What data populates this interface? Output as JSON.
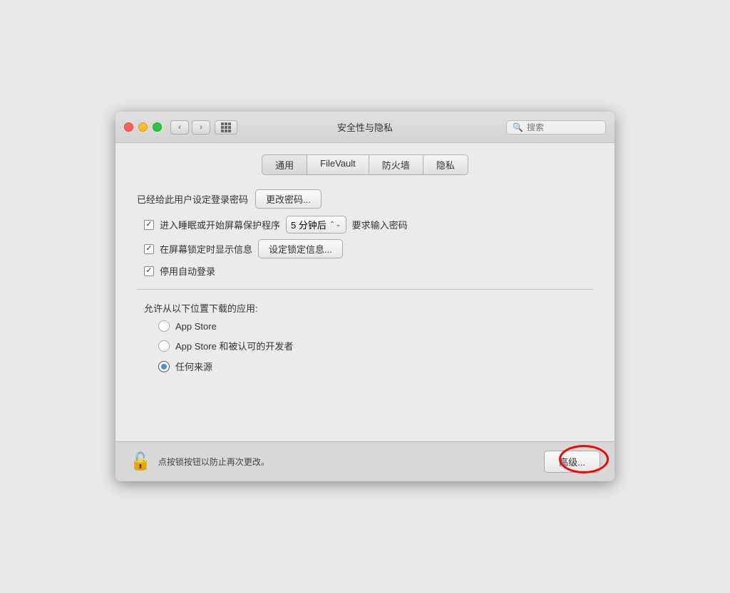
{
  "window": {
    "title": "安全性与隐私",
    "search_placeholder": "搜索"
  },
  "titlebar": {
    "back_label": "‹",
    "forward_label": "›"
  },
  "tabs": [
    {
      "id": "general",
      "label": "通用",
      "active": true
    },
    {
      "id": "filevault",
      "label": "FileVault",
      "active": false
    },
    {
      "id": "firewall",
      "label": "防火墙",
      "active": false
    },
    {
      "id": "privacy",
      "label": "隐私",
      "active": false
    }
  ],
  "general": {
    "password_label": "已经给此用户设定登录密码",
    "change_password_btn": "更改密码...",
    "sleep_label": "进入睡眠或开始屏幕保护程序",
    "sleep_dropdown": "5 分钟后",
    "sleep_after_label": "要求输入密码",
    "sleep_checked": true,
    "lock_message_label": "在屏幕锁定时显示信息",
    "lock_message_btn": "设定锁定信息...",
    "lock_message_checked": true,
    "auto_login_label": "停用自动登录",
    "auto_login_checked": true,
    "allow_apps_label": "允许从以下位置下载的应用:",
    "radio_options": [
      {
        "id": "appstore",
        "label": "App Store",
        "selected": false
      },
      {
        "id": "appstore_dev",
        "label": "App Store 和被认可的开发者",
        "selected": false
      },
      {
        "id": "anywhere",
        "label": "任何来源",
        "selected": true
      }
    ]
  },
  "footer": {
    "lock_text": "点按锁按钮以防止再次更改。",
    "advanced_btn": "高级..."
  }
}
